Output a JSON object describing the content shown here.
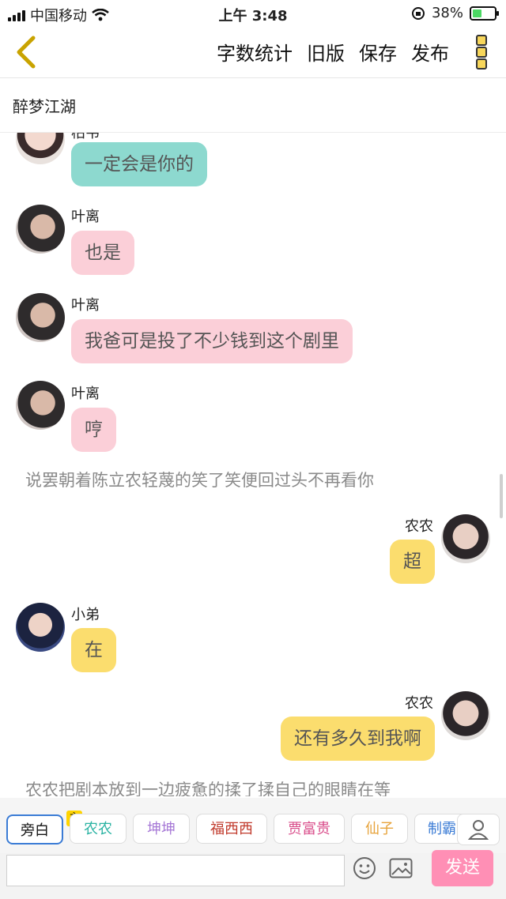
{
  "status_bar": {
    "carrier": "中国移动",
    "time": "上午 3:48",
    "battery": "38%"
  },
  "toolbar": {
    "actions": [
      "字数统计",
      "旧版",
      "保存",
      "发布"
    ]
  },
  "page_title": "醉梦江湖",
  "chat": {
    "top_partial_name": "柏韦",
    "messages": [
      {
        "speaker": "",
        "text": "一定会是你的",
        "color": "#8dd9cf"
      },
      {
        "speaker": "叶离",
        "text": "也是",
        "color": "#fbcfd8"
      },
      {
        "speaker": "叶离",
        "text": "我爸可是投了不少钱到这个剧里",
        "color": "#fbcfd8"
      },
      {
        "speaker": "叶离",
        "text": "哼",
        "color": "#fbcfd8"
      },
      {
        "narration": "说罢朝着陈立农轻蔑的笑了笑便回过头不再看你"
      },
      {
        "speaker": "农农",
        "text": "超",
        "color": "#fbdd6e"
      },
      {
        "speaker": "小弟",
        "text": "在",
        "color": "#fbdd6e"
      },
      {
        "speaker": "农农",
        "text": "还有多久到我啊",
        "color": "#fbdd6e"
      },
      {
        "narration": "农农把剧本放到一边疲惫的揉了揉自己的眼睛在等"
      }
    ]
  },
  "roles": {
    "items": [
      {
        "label": "旁白",
        "color": "#111111"
      },
      {
        "label": "农农",
        "color": "#2bb3a3"
      },
      {
        "label": "坤坤",
        "color": "#a678d6"
      },
      {
        "label": "福西西",
        "color": "#c0392b"
      },
      {
        "label": "贾富贵",
        "color": "#d94c8a"
      },
      {
        "label": "仙子",
        "color": "#e7a33b"
      },
      {
        "label": "制霸",
        "color": "#3a7bd5"
      }
    ],
    "owner_badge": "主"
  },
  "input": {
    "placeholder": "",
    "send_label": "发送"
  }
}
